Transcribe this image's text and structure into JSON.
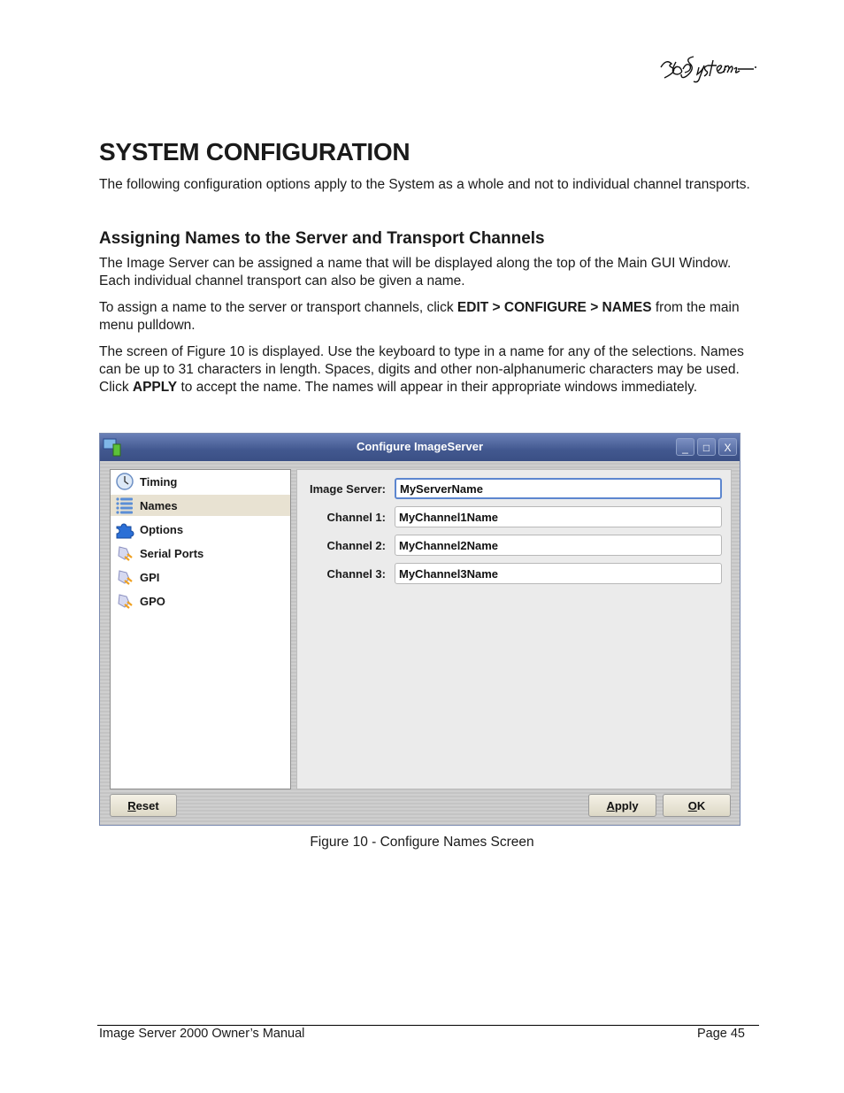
{
  "header": {
    "logo_text": "360 Systems"
  },
  "doc": {
    "title": "SYSTEM CONFIGURATION",
    "intro": "The following configuration options apply to the System as a whole and not to individual channel transports.",
    "section_title": "Assigning Names to the Server and Transport Channels",
    "para1": "The Image Server can be assigned a name that will be displayed along the top of the Main GUI Window. Each individual channel transport can also be given a name.",
    "para2_prefix": "To assign a name to the server or transport channels, click ",
    "para2_bold": "EDIT > CONFIGURE > NAMES",
    "para2_suffix": " from the main menu pulldown.",
    "para3_prefix": "The screen of Figure 10 is displayed. Use the keyboard to type in a name for any of the selections. Names can be up to 31 characters in length. Spaces, digits and other non-alphanumeric characters may be used. Click ",
    "para3_bold": "APPLY",
    "para3_suffix": " to accept the name. The names will appear in their appropriate windows immediately.",
    "caption": "Figure 10 - Configure Names Screen"
  },
  "window": {
    "title": "Configure ImageServer",
    "controls": {
      "minimize": "_",
      "maximize": "□",
      "close": "X"
    },
    "tree": [
      {
        "label": "Timing",
        "icon": "clock-icon"
      },
      {
        "label": "Names",
        "icon": "list-icon",
        "selected": true
      },
      {
        "label": "Options",
        "icon": "puzzle-icon"
      },
      {
        "label": "Serial Ports",
        "icon": "plug-icon"
      },
      {
        "label": "GPI",
        "icon": "plug-icon"
      },
      {
        "label": "GPO",
        "icon": "plug-icon"
      }
    ],
    "fields": [
      {
        "label": "Image Server:",
        "value": "MyServerName"
      },
      {
        "label": "Channel 1:",
        "value": "MyChannel1Name"
      },
      {
        "label": "Channel 2:",
        "value": "MyChannel2Name"
      },
      {
        "label": "Channel 3:",
        "value": "MyChannel3Name"
      }
    ],
    "buttons": {
      "reset_mn": "R",
      "reset_rest": "eset",
      "apply_mn": "A",
      "apply_rest": "pply",
      "ok_mn": "O",
      "ok_rest": "K"
    }
  },
  "footer": {
    "left": "Image Server 2000 Owner’s Manual",
    "right": "Page 45"
  }
}
